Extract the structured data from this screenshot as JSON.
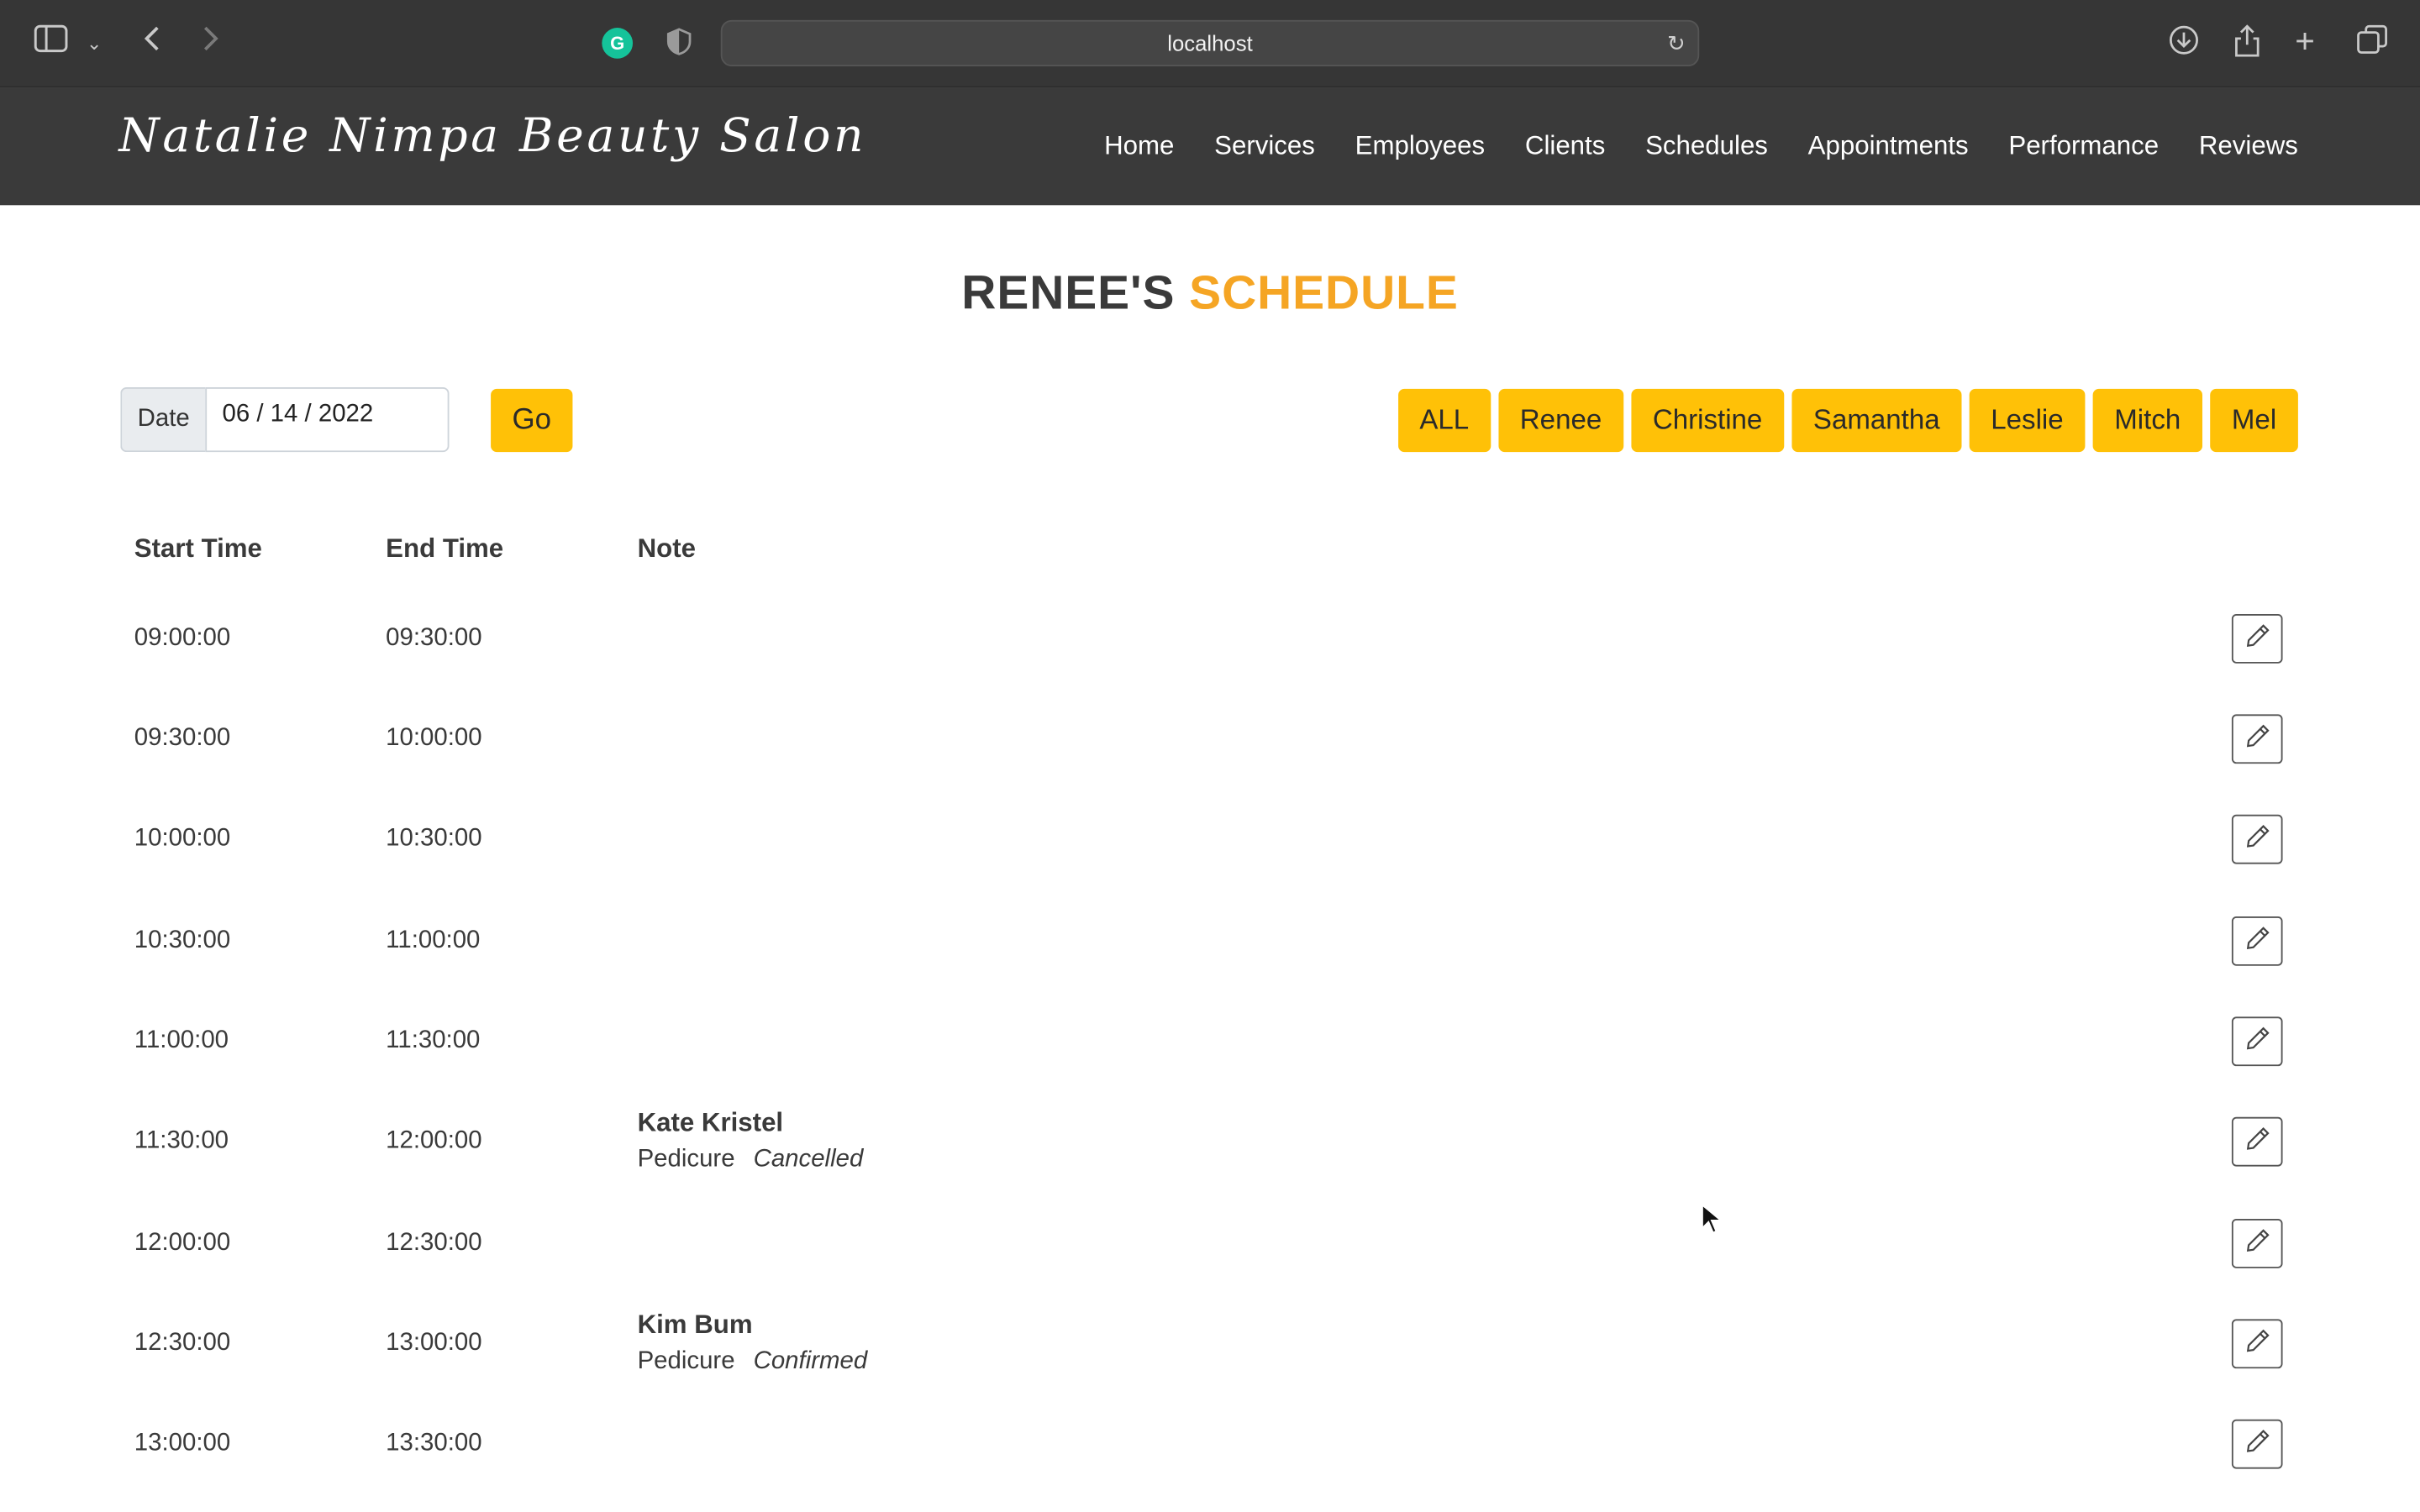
{
  "browser": {
    "url": "localhost"
  },
  "site": {
    "brand": "Natalie Nimpa Beauty Salon",
    "nav": [
      "Home",
      "Services",
      "Employees",
      "Clients",
      "Schedules",
      "Appointments",
      "Performance",
      "Reviews"
    ]
  },
  "page": {
    "heading_name": "RENEE'S",
    "heading_word": "SCHEDULE",
    "accent_color": "#f5a524",
    "button_color": "#ffc107"
  },
  "filter": {
    "date_label": "Date",
    "date_value": "06 / 14 / 2022",
    "go_label": "Go",
    "staff": [
      "ALL",
      "Renee",
      "Christine",
      "Samantha",
      "Leslie",
      "Mitch",
      "Mel"
    ]
  },
  "table": {
    "headers": {
      "start": "Start Time",
      "end": "End Time",
      "note": "Note"
    },
    "rows": [
      {
        "start": "09:00:00",
        "end": "09:30:00",
        "client": "",
        "service": "",
        "status": ""
      },
      {
        "start": "09:30:00",
        "end": "10:00:00",
        "client": "",
        "service": "",
        "status": ""
      },
      {
        "start": "10:00:00",
        "end": "10:30:00",
        "client": "",
        "service": "",
        "status": ""
      },
      {
        "start": "10:30:00",
        "end": "11:00:00",
        "client": "",
        "service": "",
        "status": ""
      },
      {
        "start": "11:00:00",
        "end": "11:30:00",
        "client": "",
        "service": "",
        "status": ""
      },
      {
        "start": "11:30:00",
        "end": "12:00:00",
        "client": "Kate Kristel",
        "service": "Pedicure",
        "status": "Cancelled"
      },
      {
        "start": "12:00:00",
        "end": "12:30:00",
        "client": "",
        "service": "",
        "status": ""
      },
      {
        "start": "12:30:00",
        "end": "13:00:00",
        "client": "Kim Bum",
        "service": "Pedicure",
        "status": "Confirmed"
      },
      {
        "start": "13:00:00",
        "end": "13:30:00",
        "client": "",
        "service": "",
        "status": ""
      }
    ]
  }
}
